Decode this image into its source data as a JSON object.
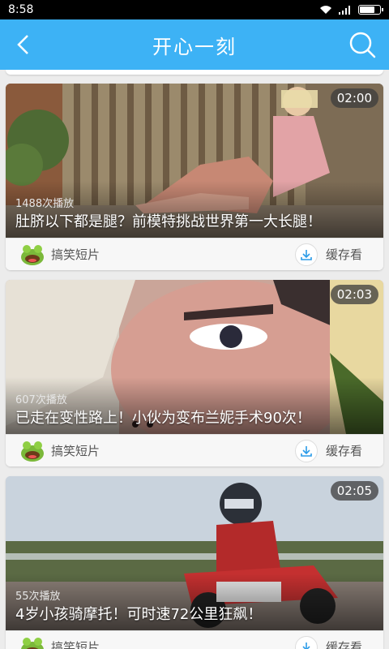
{
  "status_bar": {
    "time": "8:58"
  },
  "header": {
    "title": "开心一刻"
  },
  "videos": [
    {
      "duration": "02:00",
      "plays": "1488次播放",
      "title": "肚脐以下都是腿？前模特挑战世界第一大长腿！",
      "category": "搞笑短片",
      "cache_label": "缓存看"
    },
    {
      "duration": "02:03",
      "plays": "607次播放",
      "title": "已走在变性路上！小伙为变布兰妮手术90次！",
      "category": "搞笑短片",
      "cache_label": "缓存看"
    },
    {
      "duration": "02:05",
      "plays": "55次播放",
      "title": "4岁小孩骑摩托！可时速72公里狂飙！",
      "category": "搞笑短片",
      "cache_label": "缓存看"
    }
  ]
}
